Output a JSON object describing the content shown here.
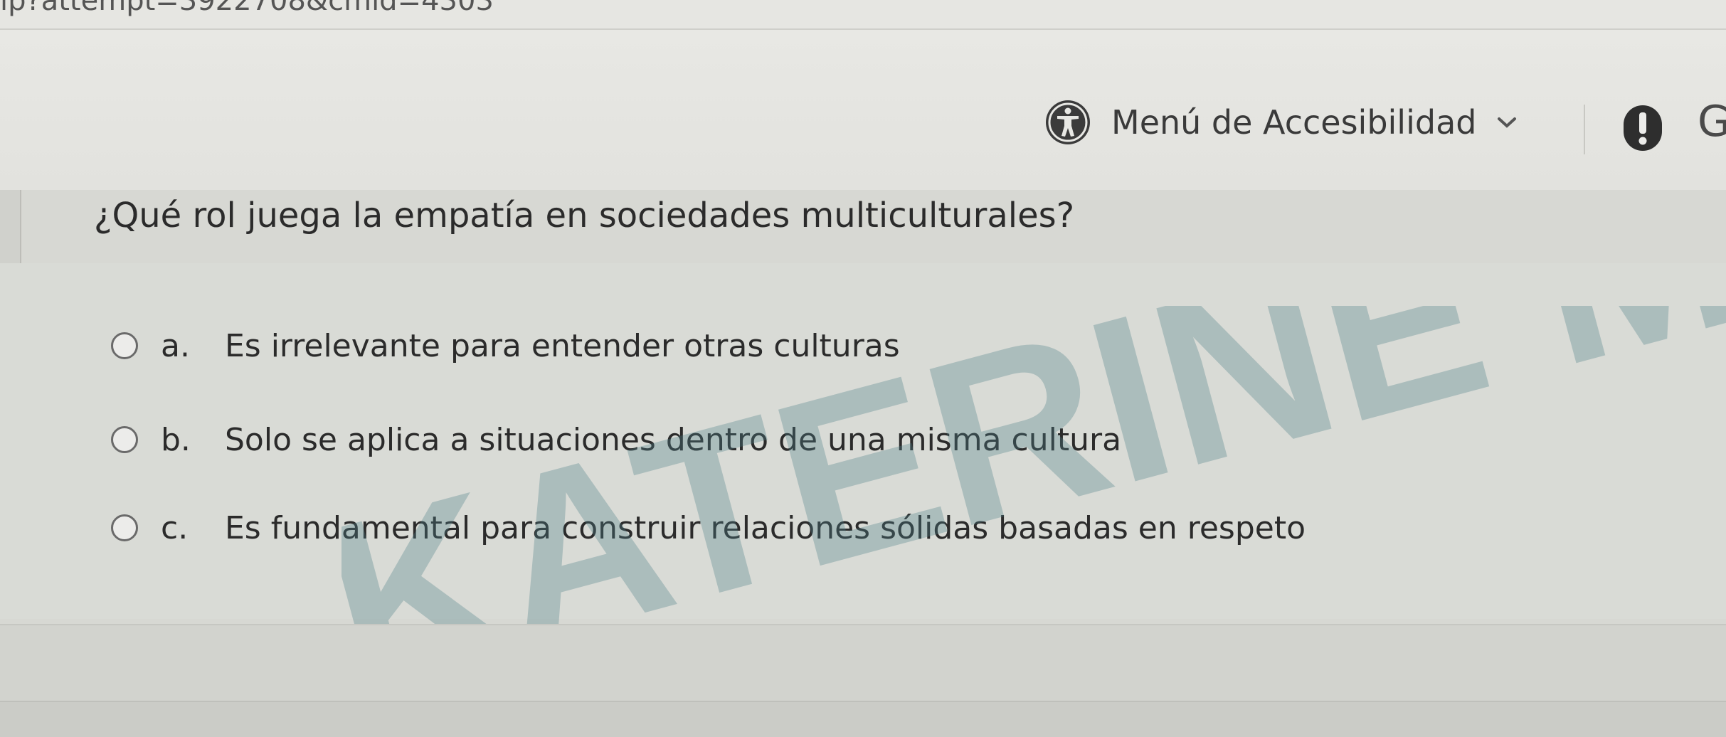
{
  "browser": {
    "url_fragment": "ip?attempt=3922708&cmid=4303"
  },
  "header": {
    "accessibility_menu_label": "Menú de Accesibilidad",
    "accessibility_icon": "accessibility-person-icon",
    "chevron_icon": "chevron-down-icon",
    "alert_icon": "exclamation-alert-icon",
    "user_initial": "G"
  },
  "question": {
    "text": "¿Qué rol juega la empatía en sociedades multiculturales?",
    "options": [
      {
        "letter": "a.",
        "text": "Es irrelevante para entender otras culturas",
        "selected": false
      },
      {
        "letter": "b.",
        "text": "Solo se aplica a situaciones dentro de una misma cultura",
        "selected": false
      },
      {
        "letter": "c.",
        "text": "Es fundamental para construir relaciones sólidas basadas en respeto",
        "selected": false
      }
    ]
  },
  "watermark": {
    "text": "KATERINE MARCE",
    "color": "#4f7f8a"
  }
}
